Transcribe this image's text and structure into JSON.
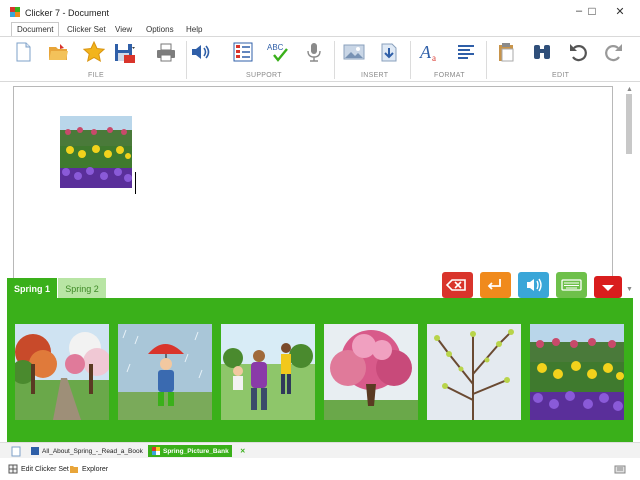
{
  "window": {
    "title": "Clicker 7 - Document",
    "minimize": "–",
    "maximize": "□",
    "close": "✕"
  },
  "menu": {
    "items": [
      "Document",
      "Clicker Set",
      "View",
      "Options",
      "Help"
    ]
  },
  "ribbon": {
    "groups": [
      "FILE",
      "SUPPORT",
      "INSERT",
      "FORMAT",
      "EDIT"
    ],
    "icons": [
      "new-document-icon",
      "open-folder-icon",
      "favorites-star-icon",
      "save-icon",
      "print-icon",
      "speech-volume-icon",
      "word-list-icon",
      "spellcheck-icon",
      "microphone-icon",
      "insert-picture-icon",
      "insert-file-icon",
      "font-style-icon",
      "align-icon",
      "clipboard-icon",
      "find-binoculars-icon",
      "undo-icon",
      "redo-icon"
    ],
    "spellcheck_text": "ABC"
  },
  "document": {
    "image": "spring-flowers-picture"
  },
  "set_tabs": [
    "Spring 1",
    "Spring 2"
  ],
  "controls": [
    {
      "name": "delete-button",
      "color": "#d9342b",
      "icon": "backspace-icon"
    },
    {
      "name": "enter-button",
      "color": "#f08a1c",
      "icon": "enter-icon"
    },
    {
      "name": "speak-button",
      "color": "#3aa6d8",
      "icon": "speak-icon"
    },
    {
      "name": "keyboard-button",
      "color": "#6ec04a",
      "icon": "keyboard-icon"
    },
    {
      "name": "hide-button",
      "color": "#d91d1d",
      "icon": "chevron-down-icon"
    }
  ],
  "grid": {
    "cells": [
      "spring-path-trees",
      "child-umbrella-rain",
      "children-playing-park",
      "blossom-tree",
      "budding-branches",
      "spring-flowers"
    ]
  },
  "taskbar": {
    "docs": [
      "All_About_Spring_-_Read_a_Book",
      "Spring_Picture_Bank"
    ],
    "close": "✕"
  },
  "statusbar": {
    "items": [
      "Edit Clicker Set",
      "Explorer"
    ]
  },
  "colors": {
    "accent_green": "#3ab01a",
    "light_green": "#b8e5a4"
  }
}
